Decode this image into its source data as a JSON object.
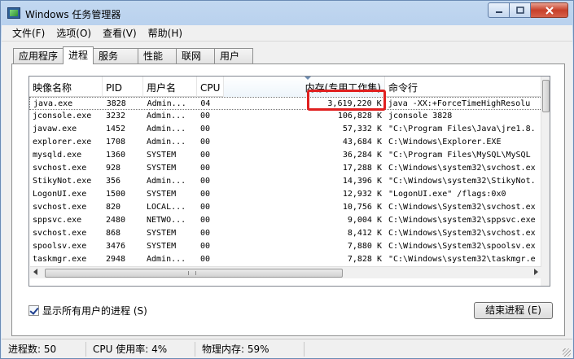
{
  "window": {
    "title": "Windows 任务管理器"
  },
  "menu": [
    "文件(F)",
    "选项(O)",
    "查看(V)",
    "帮助(H)"
  ],
  "tabs": [
    "应用程序",
    "进程",
    "服务",
    "性能",
    "联网",
    "用户"
  ],
  "active_tab": "进程",
  "columns": [
    "映像名称",
    "PID",
    "用户名",
    "CPU",
    "内存(专用工作集)",
    "命令行"
  ],
  "rows": [
    {
      "name": "java.exe",
      "pid": "3828",
      "user": "Admin...",
      "cpu": "04",
      "mem": "3,619,220 K",
      "cmd": "java -XX:+ForceTimeHighResolu"
    },
    {
      "name": "jconsole.exe",
      "pid": "3232",
      "user": "Admin...",
      "cpu": "00",
      "mem": "106,828 K",
      "cmd": "jconsole  3828"
    },
    {
      "name": "javaw.exe",
      "pid": "1452",
      "user": "Admin...",
      "cpu": "00",
      "mem": "57,332 K",
      "cmd": "\"C:\\Program Files\\Java\\jre1.8."
    },
    {
      "name": "explorer.exe",
      "pid": "1708",
      "user": "Admin...",
      "cpu": "00",
      "mem": "43,684 K",
      "cmd": "C:\\Windows\\Explorer.EXE"
    },
    {
      "name": "mysqld.exe",
      "pid": "1360",
      "user": "SYSTEM",
      "cpu": "00",
      "mem": "36,284 K",
      "cmd": "\"C:\\Program Files\\MySQL\\MySQL"
    },
    {
      "name": "svchost.exe",
      "pid": "928",
      "user": "SYSTEM",
      "cpu": "00",
      "mem": "17,288 K",
      "cmd": "C:\\Windows\\system32\\svchost.ex"
    },
    {
      "name": "StikyNot.exe",
      "pid": "356",
      "user": "Admin...",
      "cpu": "00",
      "mem": "14,396 K",
      "cmd": "\"C:\\Windows\\system32\\StikyNot."
    },
    {
      "name": "LogonUI.exe",
      "pid": "1500",
      "user": "SYSTEM",
      "cpu": "00",
      "mem": "12,932 K",
      "cmd": "\"LogonUI.exe\" /flags:0x0"
    },
    {
      "name": "svchost.exe",
      "pid": "820",
      "user": "LOCAL...",
      "cpu": "00",
      "mem": "10,756 K",
      "cmd": "C:\\Windows\\System32\\svchost.ex"
    },
    {
      "name": "sppsvc.exe",
      "pid": "2480",
      "user": "NETWO...",
      "cpu": "00",
      "mem": "9,004 K",
      "cmd": "C:\\Windows\\system32\\sppsvc.exe"
    },
    {
      "name": "svchost.exe",
      "pid": "868",
      "user": "SYSTEM",
      "cpu": "00",
      "mem": "8,412 K",
      "cmd": "C:\\Windows\\System32\\svchost.ex"
    },
    {
      "name": "spoolsv.exe",
      "pid": "3476",
      "user": "SYSTEM",
      "cpu": "00",
      "mem": "7,880 K",
      "cmd": "C:\\Windows\\System32\\spoolsv.ex"
    },
    {
      "name": "taskmgr.exe",
      "pid": "2948",
      "user": "Admin...",
      "cpu": "00",
      "mem": "7,828 K",
      "cmd": "\"C:\\Windows\\system32\\taskmgr.e"
    },
    {
      "name": "svchost.exe",
      "pid": "924",
      "user": "NETWO...",
      "cpu": "00",
      "mem": "7,604 K",
      "cmd": "C:\\Windows\\system32\\svchost.ex"
    }
  ],
  "show_all_users": {
    "label": "显示所有用户的进程 (S)",
    "checked": true
  },
  "end_process_label": "结束进程 (E)",
  "status": {
    "processes": "进程数: 50",
    "cpu": "CPU 使用率: 4%",
    "memory": "物理内存: 59%"
  }
}
